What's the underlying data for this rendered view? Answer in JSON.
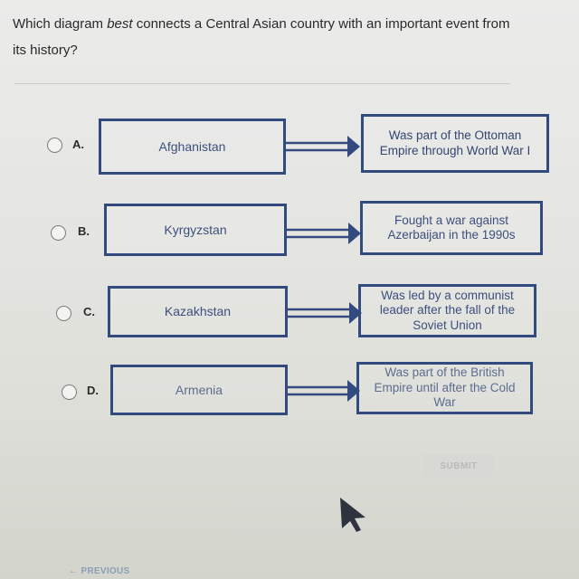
{
  "question": {
    "text_before": "Which diagram ",
    "emphasis": "best",
    "text_after": " connects a Central Asian country with an important event from its history?"
  },
  "options": [
    {
      "letter": "A.",
      "country": "Afghanistan",
      "event": "Was part of the Ottoman Empire through World War I",
      "selected": false
    },
    {
      "letter": "B.",
      "country": "Kyrgyzstan",
      "event": "Fought a war against Azerbaijan in the 1990s",
      "selected": false
    },
    {
      "letter": "C.",
      "country": "Kazakhstan",
      "event": "Was led by a communist leader after the fall of the Soviet Union",
      "selected": false
    },
    {
      "letter": "D.",
      "country": "Armenia",
      "event": "Was part of the British Empire until after the Cold War",
      "selected": false
    }
  ],
  "buttons": {
    "submit": "SUBMIT",
    "previous": "PREVIOUS"
  },
  "icons": {
    "arrow": "double-line-right-arrow",
    "previous": "left-arrow",
    "cursor": "mouse-pointer"
  },
  "colors": {
    "box_border": "#324a7e",
    "box_text": "#3d4f7e"
  }
}
